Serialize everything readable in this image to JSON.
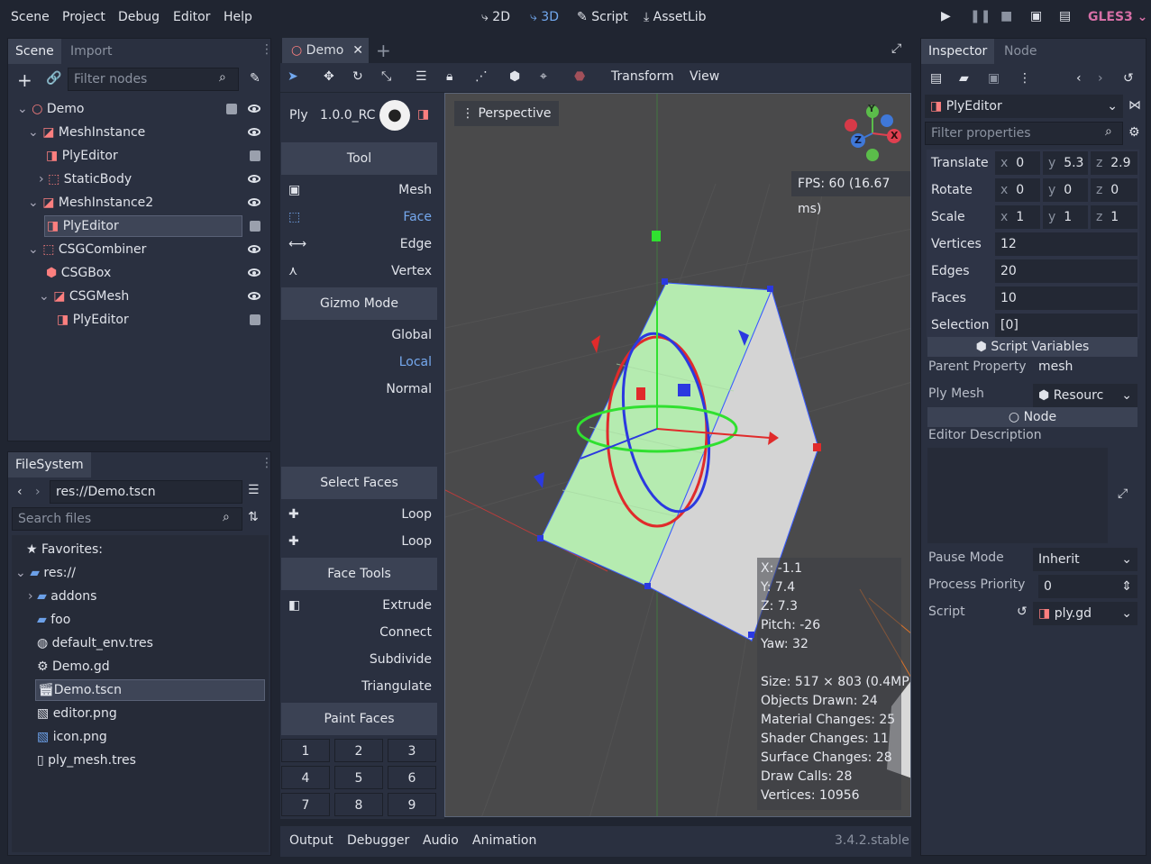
{
  "menu": [
    "Scene",
    "Project",
    "Debug",
    "Editor",
    "Help"
  ],
  "workspaces": {
    "w2d": "2D",
    "w3d": "3D",
    "script": "Script",
    "assetlib": "AssetLib"
  },
  "renderer": "GLES3",
  "scene_dock": {
    "tabs": [
      "Scene",
      "Import"
    ],
    "filter_placeholder": "Filter nodes",
    "tree": [
      "Demo",
      "MeshInstance",
      "PlyEditor",
      "StaticBody",
      "MeshInstance2",
      "PlyEditor",
      "CSGCombiner",
      "CSGBox",
      "CSGMesh",
      "PlyEditor"
    ]
  },
  "filesystem": {
    "title": "FileSystem",
    "path": "res://Demo.tscn",
    "search_placeholder": "Search files",
    "items": [
      "Favorites:",
      "res://",
      "addons",
      "foo",
      "default_env.tres",
      "Demo.gd",
      "Demo.tscn",
      "editor.png",
      "icon.png",
      "ply_mesh.tres"
    ]
  },
  "editor": {
    "tab": "Demo",
    "toolbar_menus": [
      "Transform",
      "View"
    ],
    "perspective": "Perspective",
    "fps": "FPS: 60 (16.67 ms)",
    "axis_labels": {
      "x": "X",
      "y": "Y",
      "z": "Z"
    },
    "camera_info": [
      "X: -1.1",
      "Y: 7.4",
      "Z: 7.3",
      "Pitch: -26",
      "Yaw: 32"
    ],
    "render_info": [
      "Size: 517 × 803 (0.4MP)",
      "Objects Drawn: 24",
      "Material Changes: 25",
      "Shader Changes: 11",
      "Surface Changes: 28",
      "Draw Calls: 28",
      "Vertices: 10956"
    ]
  },
  "ply": {
    "name": "Ply",
    "version": "1.0.0_RC",
    "tool_header": "Tool",
    "tools": [
      "Mesh",
      "Face",
      "Edge",
      "Vertex"
    ],
    "gizmo_header": "Gizmo Mode",
    "gizmo_modes": [
      "Global",
      "Local",
      "Normal"
    ],
    "select_faces_header": "Select Faces",
    "select_faces": [
      "Loop",
      "Loop"
    ],
    "face_tools_header": "Face Tools",
    "face_tools": [
      "Extrude",
      "Connect",
      "Subdivide",
      "Triangulate"
    ],
    "paint_faces_header": "Paint Faces",
    "paint_buttons": [
      "1",
      "2",
      "3",
      "4",
      "5",
      "6",
      "7",
      "8",
      "9"
    ]
  },
  "bottom_panel": {
    "tabs": [
      "Output",
      "Debugger",
      "Audio",
      "Animation"
    ],
    "version": "3.4.2.stable"
  },
  "inspector": {
    "tabs": [
      "Inspector",
      "Node"
    ],
    "object": "PlyEditor",
    "filter_placeholder": "Filter properties",
    "translate": {
      "label": "Translate",
      "x": "0",
      "y": "5.3",
      "z": "2.9"
    },
    "rotate": {
      "label": "Rotate",
      "x": "0",
      "y": "0",
      "z": "0"
    },
    "scale": {
      "label": "Scale",
      "x": "1",
      "y": "1",
      "z": "1"
    },
    "vertices": {
      "label": "Vertices",
      "value": "12"
    },
    "edges": {
      "label": "Edges",
      "value": "20"
    },
    "faces": {
      "label": "Faces",
      "value": "10"
    },
    "selection": {
      "label": "Selection",
      "value": "[0]"
    },
    "script_variables": "Script Variables",
    "parent_property": {
      "label": "Parent Property",
      "value": "mesh"
    },
    "ply_mesh": {
      "label": "Ply Mesh",
      "value": "Resourc"
    },
    "node_section": "Node",
    "editor_description": "Editor Description",
    "pause_mode": {
      "label": "Pause Mode",
      "value": "Inherit"
    },
    "process_priority": {
      "label": "Process Priority",
      "value": "0"
    },
    "script": {
      "label": "Script",
      "value": "ply.gd"
    }
  },
  "colors": {
    "accent": "#72a9f0",
    "selection": "#3e4557",
    "panel": "#2a3040",
    "background": "#202531"
  }
}
